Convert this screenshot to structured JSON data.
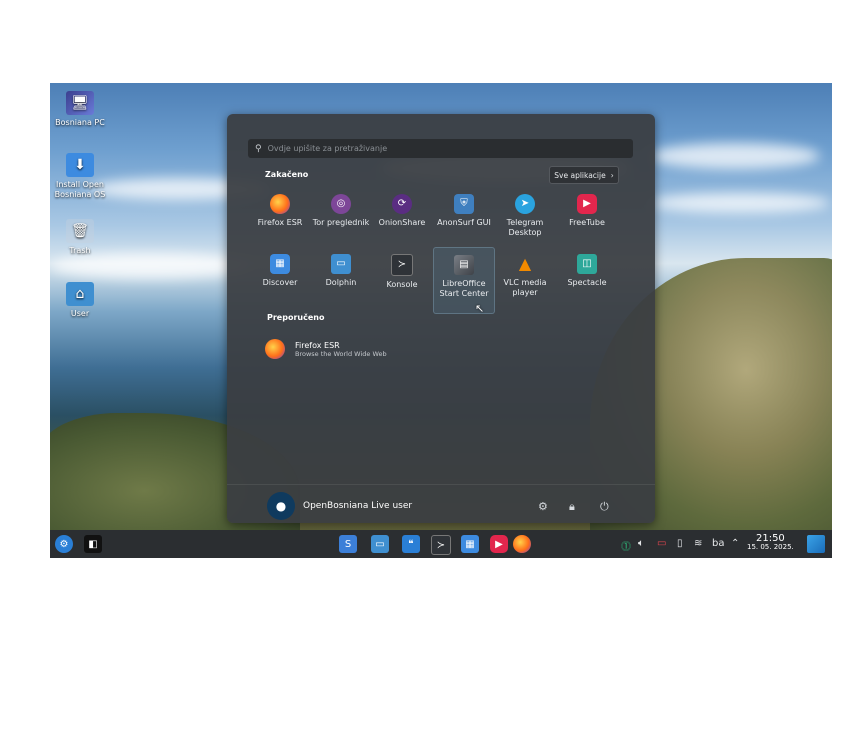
{
  "desktop": {
    "icons": [
      {
        "label": "Bosniana PC",
        "icon": "monitor-icon"
      },
      {
        "label": "Install Open Bosniana OS",
        "icon": "install-download-icon"
      },
      {
        "label": "Trash",
        "icon": "trash-icon"
      },
      {
        "label": "User",
        "icon": "home-folder-icon"
      }
    ]
  },
  "menu": {
    "search_placeholder": "Ovdje upišite za pretraživanje",
    "pinned_title": "Zakačeno",
    "all_apps_label": "Sve aplikacije",
    "pinned": [
      {
        "label": "Firefox ESR",
        "icon": "firefox-icon",
        "color": "#ff7a1a"
      },
      {
        "label": "Tor preglednik",
        "icon": "tor-icon",
        "color": "#7d4698"
      },
      {
        "label": "OnionShare",
        "icon": "onionshare-icon",
        "color": "#5a2d82"
      },
      {
        "label": "AnonSurf GUI",
        "icon": "anonsurf-shield-icon",
        "color": "#3f7fbf"
      },
      {
        "label": "Telegram Desktop",
        "icon": "telegram-icon",
        "color": "#2aa3df"
      },
      {
        "label": "FreeTube",
        "icon": "freetube-icon",
        "color": "#e2264d"
      },
      {
        "label": "Discover",
        "icon": "discover-icon",
        "color": "#3d8be0"
      },
      {
        "label": "Dolphin",
        "icon": "folder-icon",
        "color": "#3f8fd0"
      },
      {
        "label": "Konsole",
        "icon": "terminal-icon",
        "color": "#2f3338"
      },
      {
        "label": "LibreOffice Start Center",
        "icon": "libreoffice-icon",
        "color": "#5a5f66"
      },
      {
        "label": "VLC media player",
        "icon": "vlc-cone-icon",
        "color": "#f28a00"
      },
      {
        "label": "Spectacle",
        "icon": "spectacle-icon",
        "color": "#2ea89a"
      }
    ],
    "recommended_title": "Preporučeno",
    "recommended": [
      {
        "title": "Firefox ESR",
        "subtitle": "Browse the World Wide Web",
        "icon": "firefox-icon"
      }
    ],
    "user_name": "OpenBosniana Live user"
  },
  "taskbar": {
    "keyboard_layout": "ba",
    "time": "21:50",
    "date": "15. 05. 2025."
  }
}
